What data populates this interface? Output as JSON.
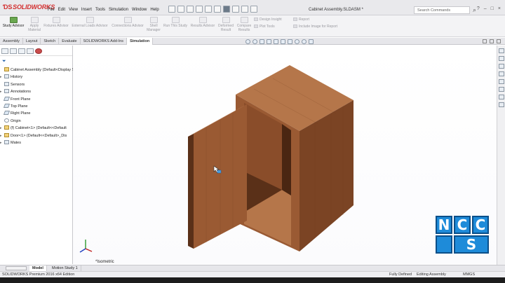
{
  "app": {
    "logo": "SOLIDWORKS",
    "document_title": "Cabinet Assembly.SLDASM *",
    "search_placeholder": "Search Commands",
    "menu": [
      "File",
      "Edit",
      "View",
      "Insert",
      "Tools",
      "Simulation",
      "Window",
      "Help"
    ]
  },
  "command_manager": {
    "study_advisor": "Study Advisor",
    "items": [
      "Apply Material",
      "Fixtures Advisor",
      "External Loads Advisor",
      "Connections Advisor",
      "Shell Manager",
      "Run This Study",
      "Results Advisor",
      "Deformed Result",
      "Compare Results"
    ],
    "row1": [
      "Design Insight",
      "Report"
    ],
    "row2": [
      "Plot Tools",
      "Include Image for Report"
    ]
  },
  "tabs": [
    "Assembly",
    "Layout",
    "Sketch",
    "Evaluate",
    "SOLIDWORKS Add-Ins",
    "Simulation"
  ],
  "active_tab": "Simulation",
  "feature_tree": [
    {
      "label": "Cabinet Assembly  (Default<Display S",
      "exp": "",
      "icon": "assembly-icon"
    },
    {
      "label": "History",
      "exp": "▸",
      "icon": "history-icon"
    },
    {
      "label": "Sensors",
      "exp": "",
      "icon": "sensors-icon"
    },
    {
      "label": "Annotations",
      "exp": "▸",
      "icon": "annotations-icon"
    },
    {
      "label": "Front Plane",
      "exp": "",
      "icon": "plane-icon"
    },
    {
      "label": "Top Plane",
      "exp": "",
      "icon": "plane-icon"
    },
    {
      "label": "Right Plane",
      "exp": "",
      "icon": "plane-icon"
    },
    {
      "label": "Origin",
      "exp": "",
      "icon": "origin-icon"
    },
    {
      "label": "(f) Cabinet<1> (Default<<Default",
      "exp": "▸",
      "icon": "part-icon"
    },
    {
      "label": "Door<1> (Default<<Default>_Dis",
      "exp": "▸",
      "icon": "part-icon"
    },
    {
      "label": "Mates",
      "exp": "▸",
      "icon": "mates-icon"
    }
  ],
  "viewport": {
    "view_label": "*Isometric",
    "watermark": [
      "N",
      "C",
      "C",
      "S"
    ],
    "colors": {
      "wood_front": "#9a5a33",
      "wood_side": "#7b4424",
      "wood_top": "#b5764a",
      "wood_inner": "#5a3018"
    }
  },
  "bottom_tabs": [
    "Model",
    "Motion Study 1"
  ],
  "status": {
    "edition": "SOLIDWORKS Premium 2016 x64 Edition",
    "definition": "Fully Defined",
    "mode": "Editing Assembly",
    "units": "MMGS"
  }
}
